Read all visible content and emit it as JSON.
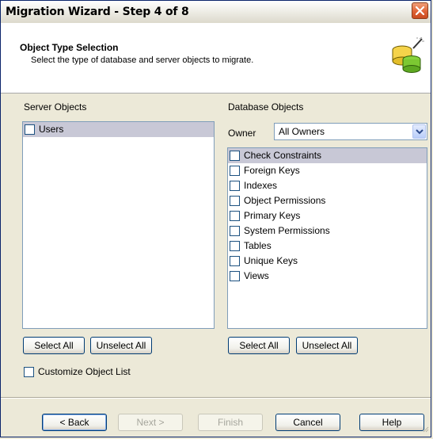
{
  "window": {
    "title": "Migration Wizard - Step 4 of 8"
  },
  "header": {
    "title": "Object Type Selection",
    "subtitle": "Select the type of database and server objects to migrate."
  },
  "server_objects": {
    "label": "Server Objects",
    "items": [
      {
        "label": "Users",
        "checked": false,
        "selected": true
      }
    ],
    "select_all": "Select All",
    "unselect_all": "Unselect All"
  },
  "database_objects": {
    "label": "Database Objects",
    "owner_label": "Owner",
    "owner_value": "All Owners",
    "items": [
      {
        "label": "Check Constraints",
        "checked": false,
        "selected": true
      },
      {
        "label": "Foreign Keys",
        "checked": false
      },
      {
        "label": "Indexes",
        "checked": false
      },
      {
        "label": "Object Permissions",
        "checked": false
      },
      {
        "label": "Primary Keys",
        "checked": false
      },
      {
        "label": "System Permissions",
        "checked": false
      },
      {
        "label": "Tables",
        "checked": false
      },
      {
        "label": "Unique Keys",
        "checked": false
      },
      {
        "label": "Views",
        "checked": false
      }
    ],
    "select_all": "Select All",
    "unselect_all": "Unselect All"
  },
  "customize": {
    "label": "Customize Object List",
    "checked": false
  },
  "footer": {
    "back": "< Back",
    "next": "Next >",
    "finish": "Finish",
    "cancel": "Cancel",
    "help": "Help"
  }
}
